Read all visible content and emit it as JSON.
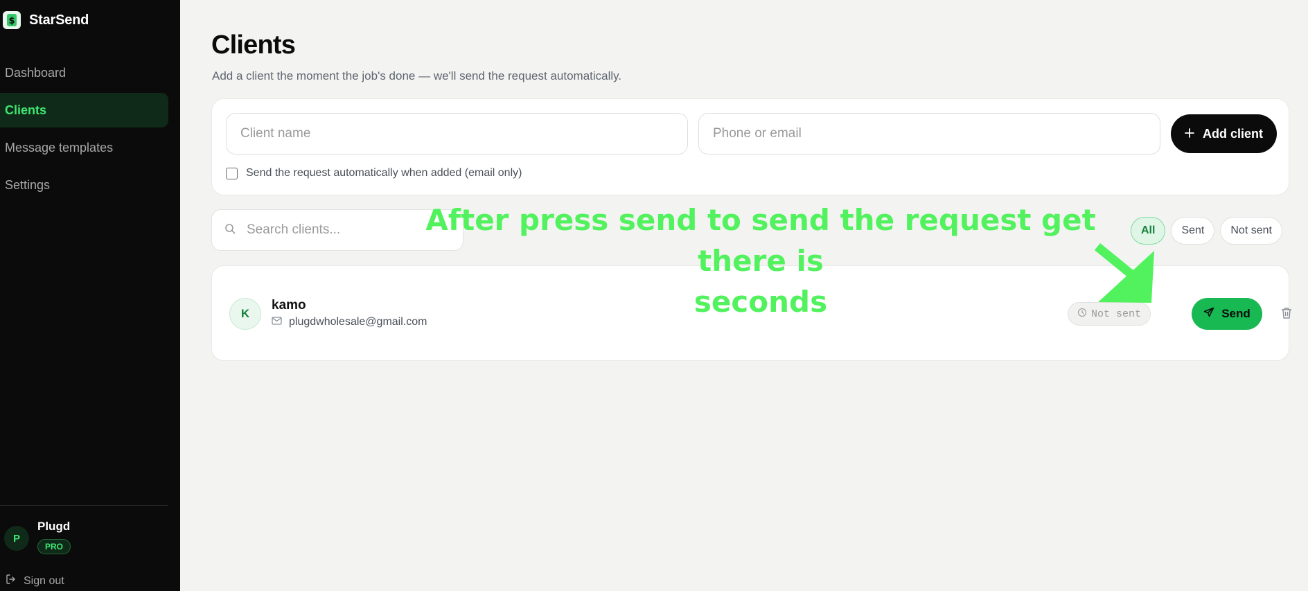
{
  "brand": {
    "name": "StarSend",
    "logo_glyph": "$"
  },
  "sidebar": {
    "items": [
      {
        "label": "Dashboard",
        "active": false
      },
      {
        "label": "Clients",
        "active": true
      },
      {
        "label": "Message templates",
        "active": false
      },
      {
        "label": "Settings",
        "active": false
      }
    ],
    "user": {
      "initial": "P",
      "name": "Plugd",
      "plan": "PRO"
    },
    "signout_label": "Sign out"
  },
  "main": {
    "title": "Clients",
    "subtitle": "Add a client the moment the job's done — we'll send the request automatically.",
    "add_form": {
      "name_placeholder": "Client name",
      "contact_placeholder": "Phone or email",
      "add_button_label": "Add client",
      "auto_send_label": "Send the request automatically when added (email only)",
      "auto_send_checked": false
    },
    "search": {
      "placeholder": "Search clients..."
    },
    "filters": [
      {
        "label": "All",
        "active": true
      },
      {
        "label": "Sent",
        "active": false
      },
      {
        "label": "Not sent",
        "active": false
      }
    ],
    "clients": [
      {
        "initial": "K",
        "name": "kamo",
        "contact": "plugdwholesale@gmail.com",
        "status": "Not sent",
        "send_label": "Send"
      }
    ]
  },
  "annotation": {
    "text_line1": "After press send  to send the request get there is",
    "text_line2": "seconds",
    "color": "#52f25e"
  },
  "colors": {
    "sidebar_bg": "#0b0b0b",
    "accent_green": "#3ee873",
    "send_button": "#18b853",
    "page_bg": "#f3f3f1"
  },
  "icons": [
    "dollar-logo-icon",
    "logout-icon",
    "plus-icon",
    "search-icon",
    "mail-icon",
    "clock-icon",
    "send-icon",
    "trash-icon"
  ]
}
